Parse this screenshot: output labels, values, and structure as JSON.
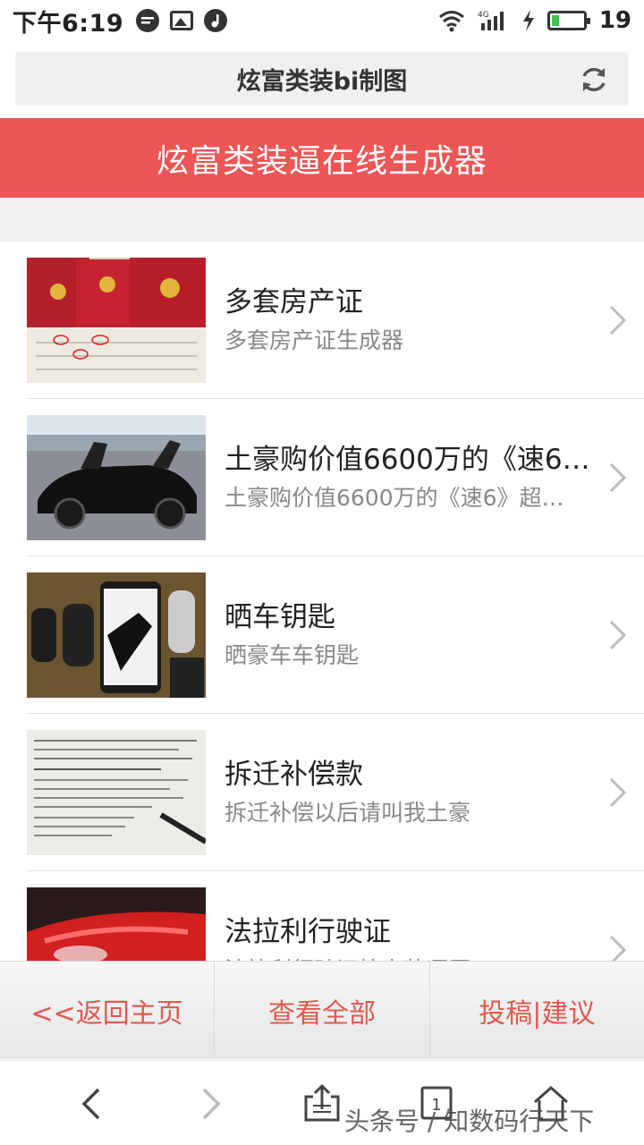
{
  "status_bar": {
    "time": "下午6:19",
    "battery_level": "19",
    "network": "4G"
  },
  "url_bar": {
    "title": "炫富类装bi制图"
  },
  "header": {
    "title": "炫富类装逼在线生成器"
  },
  "items": [
    {
      "title": "多套房产证",
      "subtitle": "多套房产证生成器"
    },
    {
      "title": "土豪购价值6600万的《速6…",
      "subtitle": "土豪购价值6600万的《速6》超…"
    },
    {
      "title": "晒车钥匙",
      "subtitle": "晒豪车车钥匙"
    },
    {
      "title": "拆迁补偿款",
      "subtitle": "拆迁补偿以后请叫我土豪"
    },
    {
      "title": "法拉利行驶证",
      "subtitle": "法拉利行驶证拉高装逼厚"
    }
  ],
  "actions": {
    "back": "<<返回主页",
    "view_all": "查看全部",
    "suggest": "投稿|建议"
  },
  "nav": {
    "tab_count": "1"
  },
  "watermark": "头条号 / 知数码行天下",
  "colors": {
    "accent": "#ee5555",
    "action_text": "#e05a52"
  }
}
